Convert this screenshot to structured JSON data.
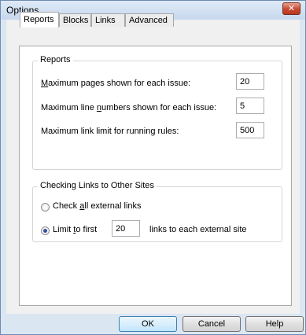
{
  "window": {
    "title": "Options",
    "close_glyph": "✕"
  },
  "tabs": [
    {
      "label": "Reports",
      "active": true
    },
    {
      "label": "Blocks",
      "active": false
    },
    {
      "label": "Links",
      "active": false
    },
    {
      "label": "Advanced",
      "active": false
    }
  ],
  "reports_group": {
    "title": "Reports",
    "rows": [
      {
        "label_before": "",
        "label_mnemonic": "M",
        "label_after": "aximum pages shown for each issue:",
        "value": "20"
      },
      {
        "label_before": "Maximum line ",
        "label_mnemonic": "n",
        "label_after": "umbers shown for each issue:",
        "value": "5"
      },
      {
        "label_before": "Maximum link limit for running rules:",
        "label_mnemonic": "",
        "label_after": "",
        "value": "500"
      }
    ]
  },
  "links_group": {
    "title": "Checking Links to Other Sites",
    "option_check_all": {
      "before": "Check ",
      "mnemonic": "a",
      "after": "ll external links",
      "selected": false
    },
    "option_limit": {
      "before": "Limit ",
      "mnemonic": "t",
      "after": "o first",
      "selected": true
    },
    "limit_value": "20",
    "limit_suffix": "links to each external site"
  },
  "buttons": {
    "ok": "OK",
    "cancel": "Cancel",
    "help": "Help"
  },
  "colors": {
    "frame": "#dbe6f3",
    "radio_selected": "#2c52a6",
    "close_button": "#c8462f"
  }
}
